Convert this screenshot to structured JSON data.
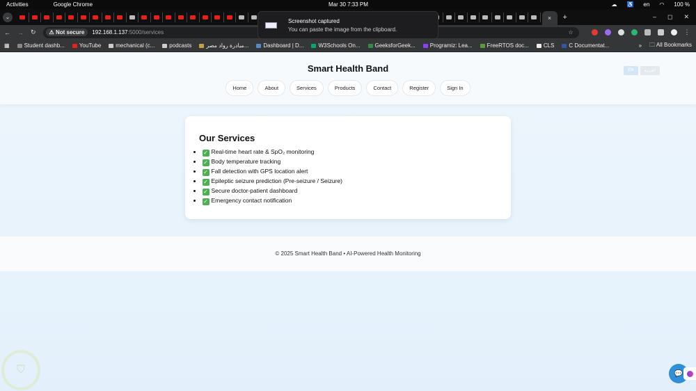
{
  "system": {
    "activities": "Activities",
    "app": "Google Chrome",
    "clock": "Mar 30   7:33 PM",
    "lang": "en",
    "battery": "100 %"
  },
  "tabs": {
    "icons": [
      "youtube",
      "youtube",
      "youtube",
      "youtube",
      "youtube",
      "youtube",
      "youtube",
      "youtube",
      "youtube",
      "recording",
      "youtube",
      "youtube",
      "youtube",
      "youtube",
      "youtube",
      "youtube",
      "youtube",
      "youtube",
      "k-site",
      "other",
      "other",
      "other",
      "other",
      "other",
      "other",
      "other",
      "other",
      "other",
      "other",
      "other",
      "other",
      "other",
      "other",
      "other",
      "other",
      "other",
      "other",
      "other",
      "other",
      "other",
      "other",
      "other",
      "other"
    ],
    "active_close": "×",
    "new_tab": "+"
  },
  "address": {
    "not_secure": "Not secure",
    "host": "192.168.1.137",
    "path": ":5000/services"
  },
  "bookmarks": [
    {
      "label": "Student dashb...",
      "color": "#888"
    },
    {
      "label": "YouTube",
      "color": "#e62117"
    },
    {
      "label": "mechanical (c...",
      "color": "#ccc"
    },
    {
      "label": "podcasts",
      "color": "#ccc"
    },
    {
      "label": "مبادرة رواد مصر...",
      "color": "#c9a040"
    },
    {
      "label": "Dashboard | D...",
      "color": "#5588cc"
    },
    {
      "label": "W3Schools On...",
      "color": "#04aa6d"
    },
    {
      "label": "GeeksforGeek...",
      "color": "#2f8d46"
    },
    {
      "label": "Programiz: Lea...",
      "color": "#8a3ffc"
    },
    {
      "label": "FreeRTOS doc...",
      "color": "#5a9a3a"
    },
    {
      "label": "CLS",
      "color": "#eee"
    },
    {
      "label": "C Documentat...",
      "color": "#3355aa"
    }
  ],
  "bookmarks_more": "»",
  "all_bookmarks": "All Bookmarks",
  "notification": {
    "title": "Screenshot captured",
    "body": "You can paste the image from the clipboard."
  },
  "site": {
    "brand": "Smart Health Band",
    "lang": [
      "EN",
      "العربية"
    ],
    "nav": [
      "Home",
      "About",
      "Services",
      "Products",
      "Contact",
      "Register",
      "Sign In"
    ],
    "services_title": "Our Services",
    "services": [
      "Real-time heart rate & SpO₂ monitoring",
      "Body temperature tracking",
      "Fall detection with GPS location alert",
      "Epileptic seizure prediction (Pre-seizure / Seizure)",
      "Secure doctor-patient dashboard",
      "Emergency contact notification"
    ],
    "footer": "© 2025 Smart Health Band • AI-Powered Health Monitoring"
  }
}
